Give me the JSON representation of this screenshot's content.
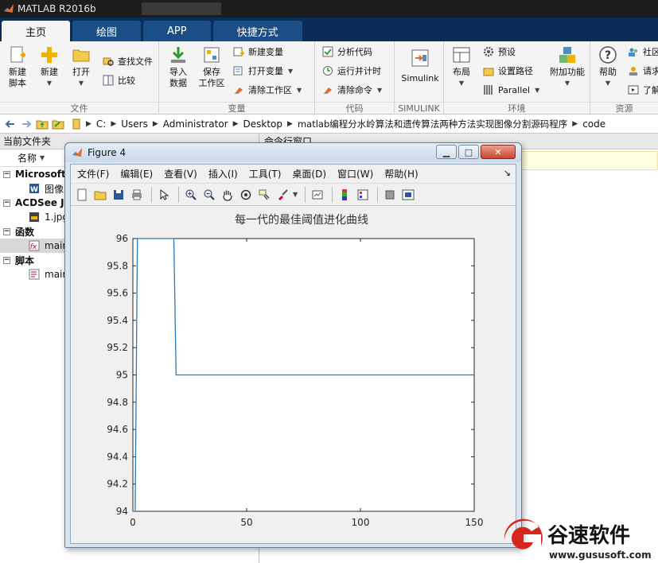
{
  "app": {
    "title": "MATLAB R2016b"
  },
  "tabs": [
    {
      "label": "主页",
      "active": true
    },
    {
      "label": "绘图",
      "active": false
    },
    {
      "label": "APP",
      "active": false
    },
    {
      "label": "快捷方式",
      "active": false
    }
  ],
  "ribbon": {
    "file_group": {
      "label": "文件",
      "new_script": "新建\n脚本",
      "new": "新建",
      "open": "打开",
      "find_files": "查找文件",
      "compare": "比较"
    },
    "variable_group": {
      "label": "变量",
      "import_data": "导入\n数据",
      "save_workspace": "保存\n工作区",
      "new_variable": "新建变量",
      "open_variable": "打开变量",
      "clear_workspace": "清除工作区"
    },
    "code_group": {
      "label": "代码",
      "analyze_code": "分析代码",
      "run_and_time": "运行并计时",
      "clear_commands": "清除命令"
    },
    "simulink_group": {
      "label": "SIMULINK",
      "simulink": "Simulink"
    },
    "environment_group": {
      "label": "环境",
      "layout": "布局",
      "preferences": "预设",
      "set_path": "设置路径",
      "parallel": "Parallel",
      "add_ons": "附加功能"
    },
    "resources_group": {
      "label": "资源",
      "help": "帮助",
      "community": "社区",
      "request": "请求",
      "learn": "了解"
    }
  },
  "address": {
    "crumbs": [
      "C:",
      "Users",
      "Administrator",
      "Desktop",
      "matlab编程分水岭算法和遗传算法两种方法实现图像分割源码程序",
      "code"
    ]
  },
  "current_folder": {
    "title": "当前文件夹",
    "name_header": "名称",
    "groups": [
      {
        "header": "Microsoft",
        "items": [
          {
            "name": "图像",
            "icon": "word-doc-icon"
          }
        ]
      },
      {
        "header": "ACDSee JI",
        "items": [
          {
            "name": "1.jpg",
            "icon": "jpg-file-icon"
          }
        ]
      },
      {
        "header": "函数",
        "items": [
          {
            "name": "main",
            "icon": "function-file-icon",
            "selected": true
          }
        ]
      },
      {
        "header": "脚本",
        "items": [
          {
            "name": "main",
            "icon": "script-file-icon"
          }
        ]
      }
    ]
  },
  "command_window": {
    "title": "命令行窗口"
  },
  "figure": {
    "title": "Figure 4",
    "menus": [
      "文件(F)",
      "编辑(E)",
      "查看(V)",
      "插入(I)",
      "工具(T)",
      "桌面(D)",
      "窗口(W)",
      "帮助(H)"
    ]
  },
  "watermark": {
    "brand": "谷速软件",
    "url": "www.gususoft.com"
  },
  "colors": {
    "accent_blue": "#0a2d57",
    "tab_blue": "#1b4e86",
    "line_blue": "#2b7bba",
    "watermark_red": "#d9261c"
  },
  "chart_data": {
    "type": "line",
    "title": "每一代的最佳阈值进化曲线",
    "xlabel": "",
    "ylabel": "",
    "xlim": [
      0,
      150
    ],
    "ylim": [
      94,
      96
    ],
    "xticks": [
      0,
      50,
      100,
      150
    ],
    "yticks": [
      94,
      94.2,
      94.4,
      94.6,
      94.8,
      95,
      95.2,
      95.4,
      95.6,
      95.8,
      96
    ],
    "grid": false,
    "series": [
      {
        "color": "#2b7bba",
        "points": [
          [
            0,
            94
          ],
          [
            1,
            94
          ],
          [
            2,
            96
          ],
          [
            18,
            96
          ],
          [
            19,
            95
          ],
          [
            150,
            95
          ]
        ]
      }
    ]
  }
}
